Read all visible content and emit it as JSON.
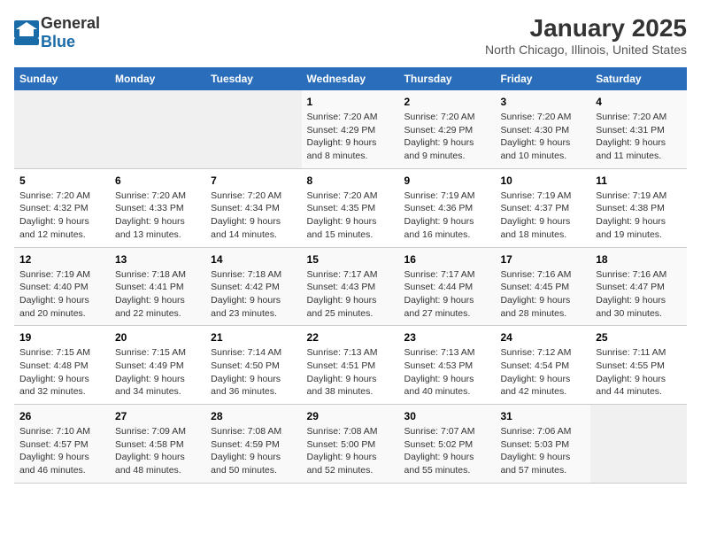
{
  "logo": {
    "general": "General",
    "blue": "Blue"
  },
  "title": "January 2025",
  "subtitle": "North Chicago, Illinois, United States",
  "headers": [
    "Sunday",
    "Monday",
    "Tuesday",
    "Wednesday",
    "Thursday",
    "Friday",
    "Saturday"
  ],
  "weeks": [
    [
      {
        "day": "",
        "info": ""
      },
      {
        "day": "",
        "info": ""
      },
      {
        "day": "",
        "info": ""
      },
      {
        "day": "1",
        "info": "Sunrise: 7:20 AM\nSunset: 4:29 PM\nDaylight: 9 hours\nand 8 minutes."
      },
      {
        "day": "2",
        "info": "Sunrise: 7:20 AM\nSunset: 4:29 PM\nDaylight: 9 hours\nand 9 minutes."
      },
      {
        "day": "3",
        "info": "Sunrise: 7:20 AM\nSunset: 4:30 PM\nDaylight: 9 hours\nand 10 minutes."
      },
      {
        "day": "4",
        "info": "Sunrise: 7:20 AM\nSunset: 4:31 PM\nDaylight: 9 hours\nand 11 minutes."
      }
    ],
    [
      {
        "day": "5",
        "info": "Sunrise: 7:20 AM\nSunset: 4:32 PM\nDaylight: 9 hours\nand 12 minutes."
      },
      {
        "day": "6",
        "info": "Sunrise: 7:20 AM\nSunset: 4:33 PM\nDaylight: 9 hours\nand 13 minutes."
      },
      {
        "day": "7",
        "info": "Sunrise: 7:20 AM\nSunset: 4:34 PM\nDaylight: 9 hours\nand 14 minutes."
      },
      {
        "day": "8",
        "info": "Sunrise: 7:20 AM\nSunset: 4:35 PM\nDaylight: 9 hours\nand 15 minutes."
      },
      {
        "day": "9",
        "info": "Sunrise: 7:19 AM\nSunset: 4:36 PM\nDaylight: 9 hours\nand 16 minutes."
      },
      {
        "day": "10",
        "info": "Sunrise: 7:19 AM\nSunset: 4:37 PM\nDaylight: 9 hours\nand 18 minutes."
      },
      {
        "day": "11",
        "info": "Sunrise: 7:19 AM\nSunset: 4:38 PM\nDaylight: 9 hours\nand 19 minutes."
      }
    ],
    [
      {
        "day": "12",
        "info": "Sunrise: 7:19 AM\nSunset: 4:40 PM\nDaylight: 9 hours\nand 20 minutes."
      },
      {
        "day": "13",
        "info": "Sunrise: 7:18 AM\nSunset: 4:41 PM\nDaylight: 9 hours\nand 22 minutes."
      },
      {
        "day": "14",
        "info": "Sunrise: 7:18 AM\nSunset: 4:42 PM\nDaylight: 9 hours\nand 23 minutes."
      },
      {
        "day": "15",
        "info": "Sunrise: 7:17 AM\nSunset: 4:43 PM\nDaylight: 9 hours\nand 25 minutes."
      },
      {
        "day": "16",
        "info": "Sunrise: 7:17 AM\nSunset: 4:44 PM\nDaylight: 9 hours\nand 27 minutes."
      },
      {
        "day": "17",
        "info": "Sunrise: 7:16 AM\nSunset: 4:45 PM\nDaylight: 9 hours\nand 28 minutes."
      },
      {
        "day": "18",
        "info": "Sunrise: 7:16 AM\nSunset: 4:47 PM\nDaylight: 9 hours\nand 30 minutes."
      }
    ],
    [
      {
        "day": "19",
        "info": "Sunrise: 7:15 AM\nSunset: 4:48 PM\nDaylight: 9 hours\nand 32 minutes."
      },
      {
        "day": "20",
        "info": "Sunrise: 7:15 AM\nSunset: 4:49 PM\nDaylight: 9 hours\nand 34 minutes."
      },
      {
        "day": "21",
        "info": "Sunrise: 7:14 AM\nSunset: 4:50 PM\nDaylight: 9 hours\nand 36 minutes."
      },
      {
        "day": "22",
        "info": "Sunrise: 7:13 AM\nSunset: 4:51 PM\nDaylight: 9 hours\nand 38 minutes."
      },
      {
        "day": "23",
        "info": "Sunrise: 7:13 AM\nSunset: 4:53 PM\nDaylight: 9 hours\nand 40 minutes."
      },
      {
        "day": "24",
        "info": "Sunrise: 7:12 AM\nSunset: 4:54 PM\nDaylight: 9 hours\nand 42 minutes."
      },
      {
        "day": "25",
        "info": "Sunrise: 7:11 AM\nSunset: 4:55 PM\nDaylight: 9 hours\nand 44 minutes."
      }
    ],
    [
      {
        "day": "26",
        "info": "Sunrise: 7:10 AM\nSunset: 4:57 PM\nDaylight: 9 hours\nand 46 minutes."
      },
      {
        "day": "27",
        "info": "Sunrise: 7:09 AM\nSunset: 4:58 PM\nDaylight: 9 hours\nand 48 minutes."
      },
      {
        "day": "28",
        "info": "Sunrise: 7:08 AM\nSunset: 4:59 PM\nDaylight: 9 hours\nand 50 minutes."
      },
      {
        "day": "29",
        "info": "Sunrise: 7:08 AM\nSunset: 5:00 PM\nDaylight: 9 hours\nand 52 minutes."
      },
      {
        "day": "30",
        "info": "Sunrise: 7:07 AM\nSunset: 5:02 PM\nDaylight: 9 hours\nand 55 minutes."
      },
      {
        "day": "31",
        "info": "Sunrise: 7:06 AM\nSunset: 5:03 PM\nDaylight: 9 hours\nand 57 minutes."
      },
      {
        "day": "",
        "info": ""
      }
    ]
  ]
}
